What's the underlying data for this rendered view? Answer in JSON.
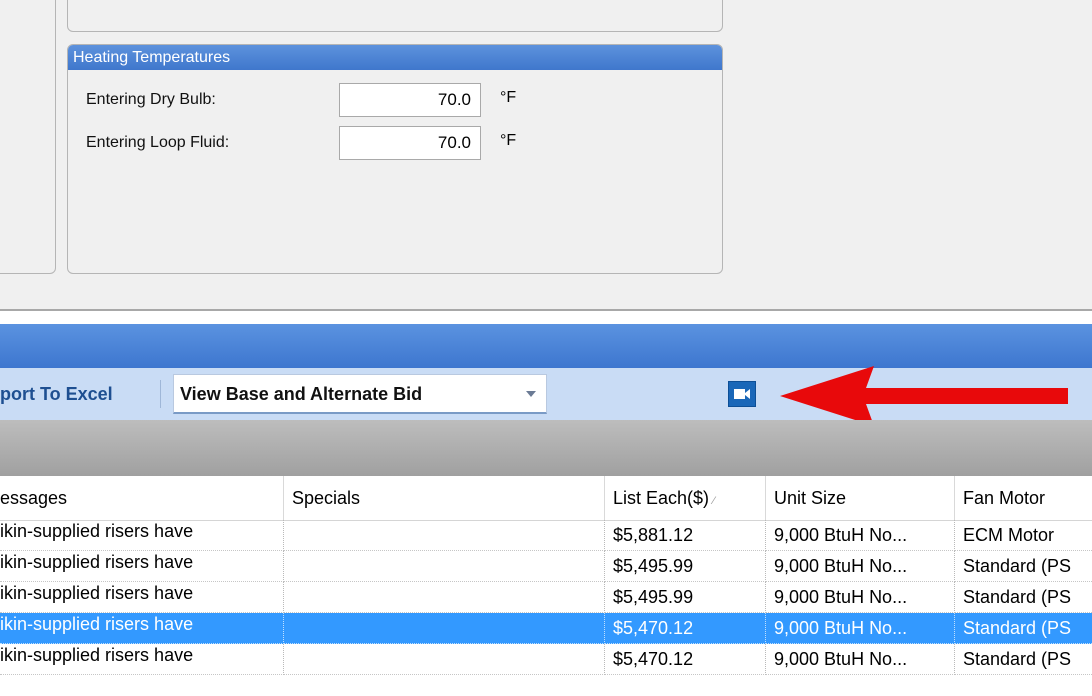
{
  "heating": {
    "title": "Heating Temperatures",
    "entering_dry_bulb": {
      "label": "Entering Dry Bulb:",
      "value": "70.0",
      "unit": "°F"
    },
    "entering_loop_fluid": {
      "label": "Entering Loop Fluid:",
      "value": "70.0",
      "unit": "°F"
    }
  },
  "toolbar": {
    "export_label": "port To Excel",
    "view_select": "View Base and Alternate Bid",
    "camera_icon": "video-camera-icon"
  },
  "annotation": {
    "arrow_color": "#e8090b"
  },
  "grid": {
    "columns": [
      "essages",
      "Specials",
      "List Each($)",
      "Unit Size",
      "Fan Motor"
    ],
    "rows": [
      {
        "messages": "ikin-supplied risers have",
        "messages_overflow": "...",
        "specials": "",
        "list_each": "$5,881.12",
        "unit_size": "9,000 BtuH No...",
        "fan_motor": "ECM Motor"
      },
      {
        "messages": "ikin-supplied risers have",
        "messages_overflow": "...",
        "specials": "",
        "list_each": "$5,495.99",
        "unit_size": "9,000 BtuH No...",
        "fan_motor": "Standard (PS"
      },
      {
        "messages": "ikin-supplied risers have",
        "messages_overflow": "...",
        "specials": "",
        "list_each": "$5,495.99",
        "unit_size": "9,000 BtuH No...",
        "fan_motor": "Standard (PS"
      },
      {
        "messages": "ikin-supplied risers have",
        "messages_overflow": "...",
        "specials": "",
        "list_each": "$5,470.12",
        "unit_size": "9,000 BtuH No...",
        "fan_motor": "Standard (PS"
      },
      {
        "messages": "ikin-supplied risers have",
        "messages_overflow": "...",
        "specials": "",
        "list_each": "$5,470.12",
        "unit_size": "9,000 BtuH No...",
        "fan_motor": "Standard (PS"
      }
    ],
    "selected_row_index": 3
  }
}
